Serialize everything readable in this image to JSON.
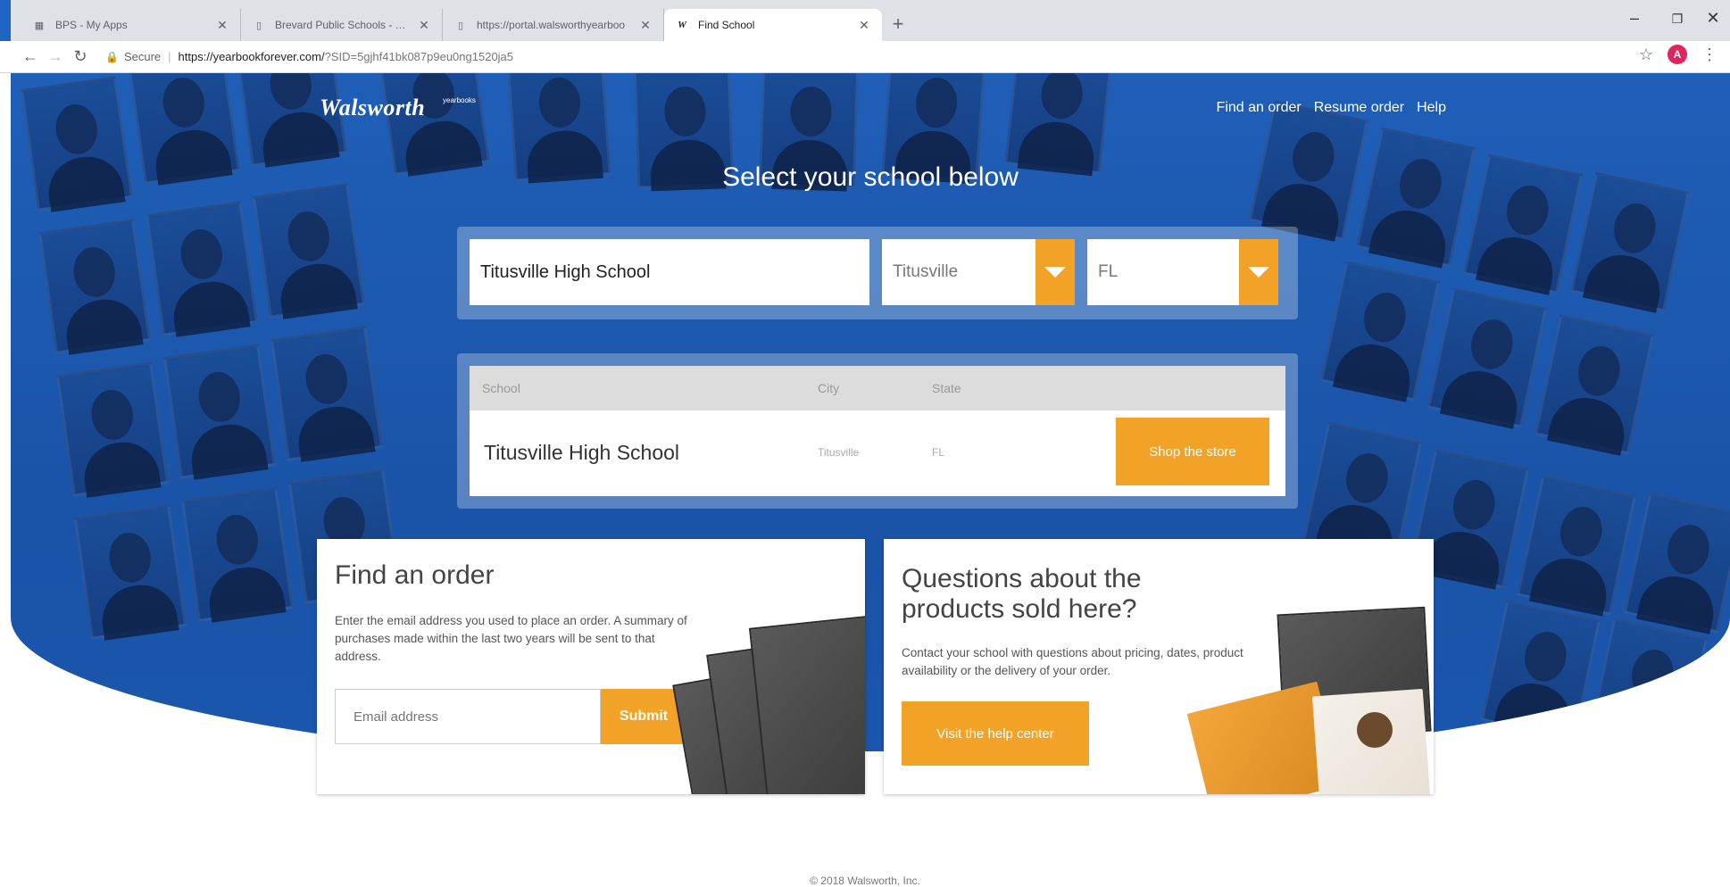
{
  "browser": {
    "tabs": [
      {
        "title": "BPS - My Apps",
        "favicon": "apps-icon"
      },
      {
        "title": "Brevard Public Schools - You ha",
        "favicon": "page-icon"
      },
      {
        "title": "https://portal.walsworthyearboo",
        "favicon": "page-icon"
      },
      {
        "title": "Find School",
        "favicon": "walsworth-icon"
      }
    ],
    "url_secure": "Secure",
    "url_host": "https://yearbookforever.com/",
    "url_path": "?SID=5gjhf41bk087p9eu0ng1520ja5",
    "profile_initial": "A"
  },
  "header": {
    "logo": "Walsworth",
    "logo_sup": "yearbooks",
    "nav": [
      "Find an order",
      "Resume order",
      "Help"
    ]
  },
  "hero": {
    "title": "Select your school below"
  },
  "search": {
    "school_value": "Titusville High School",
    "city_value": "Titusville",
    "state_value": "FL"
  },
  "results": {
    "headers": {
      "school": "School",
      "city": "City",
      "state": "State"
    },
    "rows": [
      {
        "school": "Titusville High School",
        "city": "Titusville",
        "state": "FL",
        "action": "Shop the store"
      }
    ]
  },
  "find_order": {
    "title": "Find an order",
    "description": "Enter the email address you used to place an order. A summary of purchases made within the last two years will be sent to that address.",
    "email_placeholder": "Email address",
    "submit_label": "Submit"
  },
  "questions": {
    "title_line1": "Questions about the",
    "title_line2": "products sold here?",
    "description": "Contact your school with questions about pricing, dates, product availability or the delivery of your order.",
    "button_label": "Visit the help center"
  },
  "footer": {
    "copyright": "© 2018 Walsworth, Inc."
  },
  "colors": {
    "hero_blue": "#1f5fb8",
    "accent_orange": "#f2a227"
  }
}
